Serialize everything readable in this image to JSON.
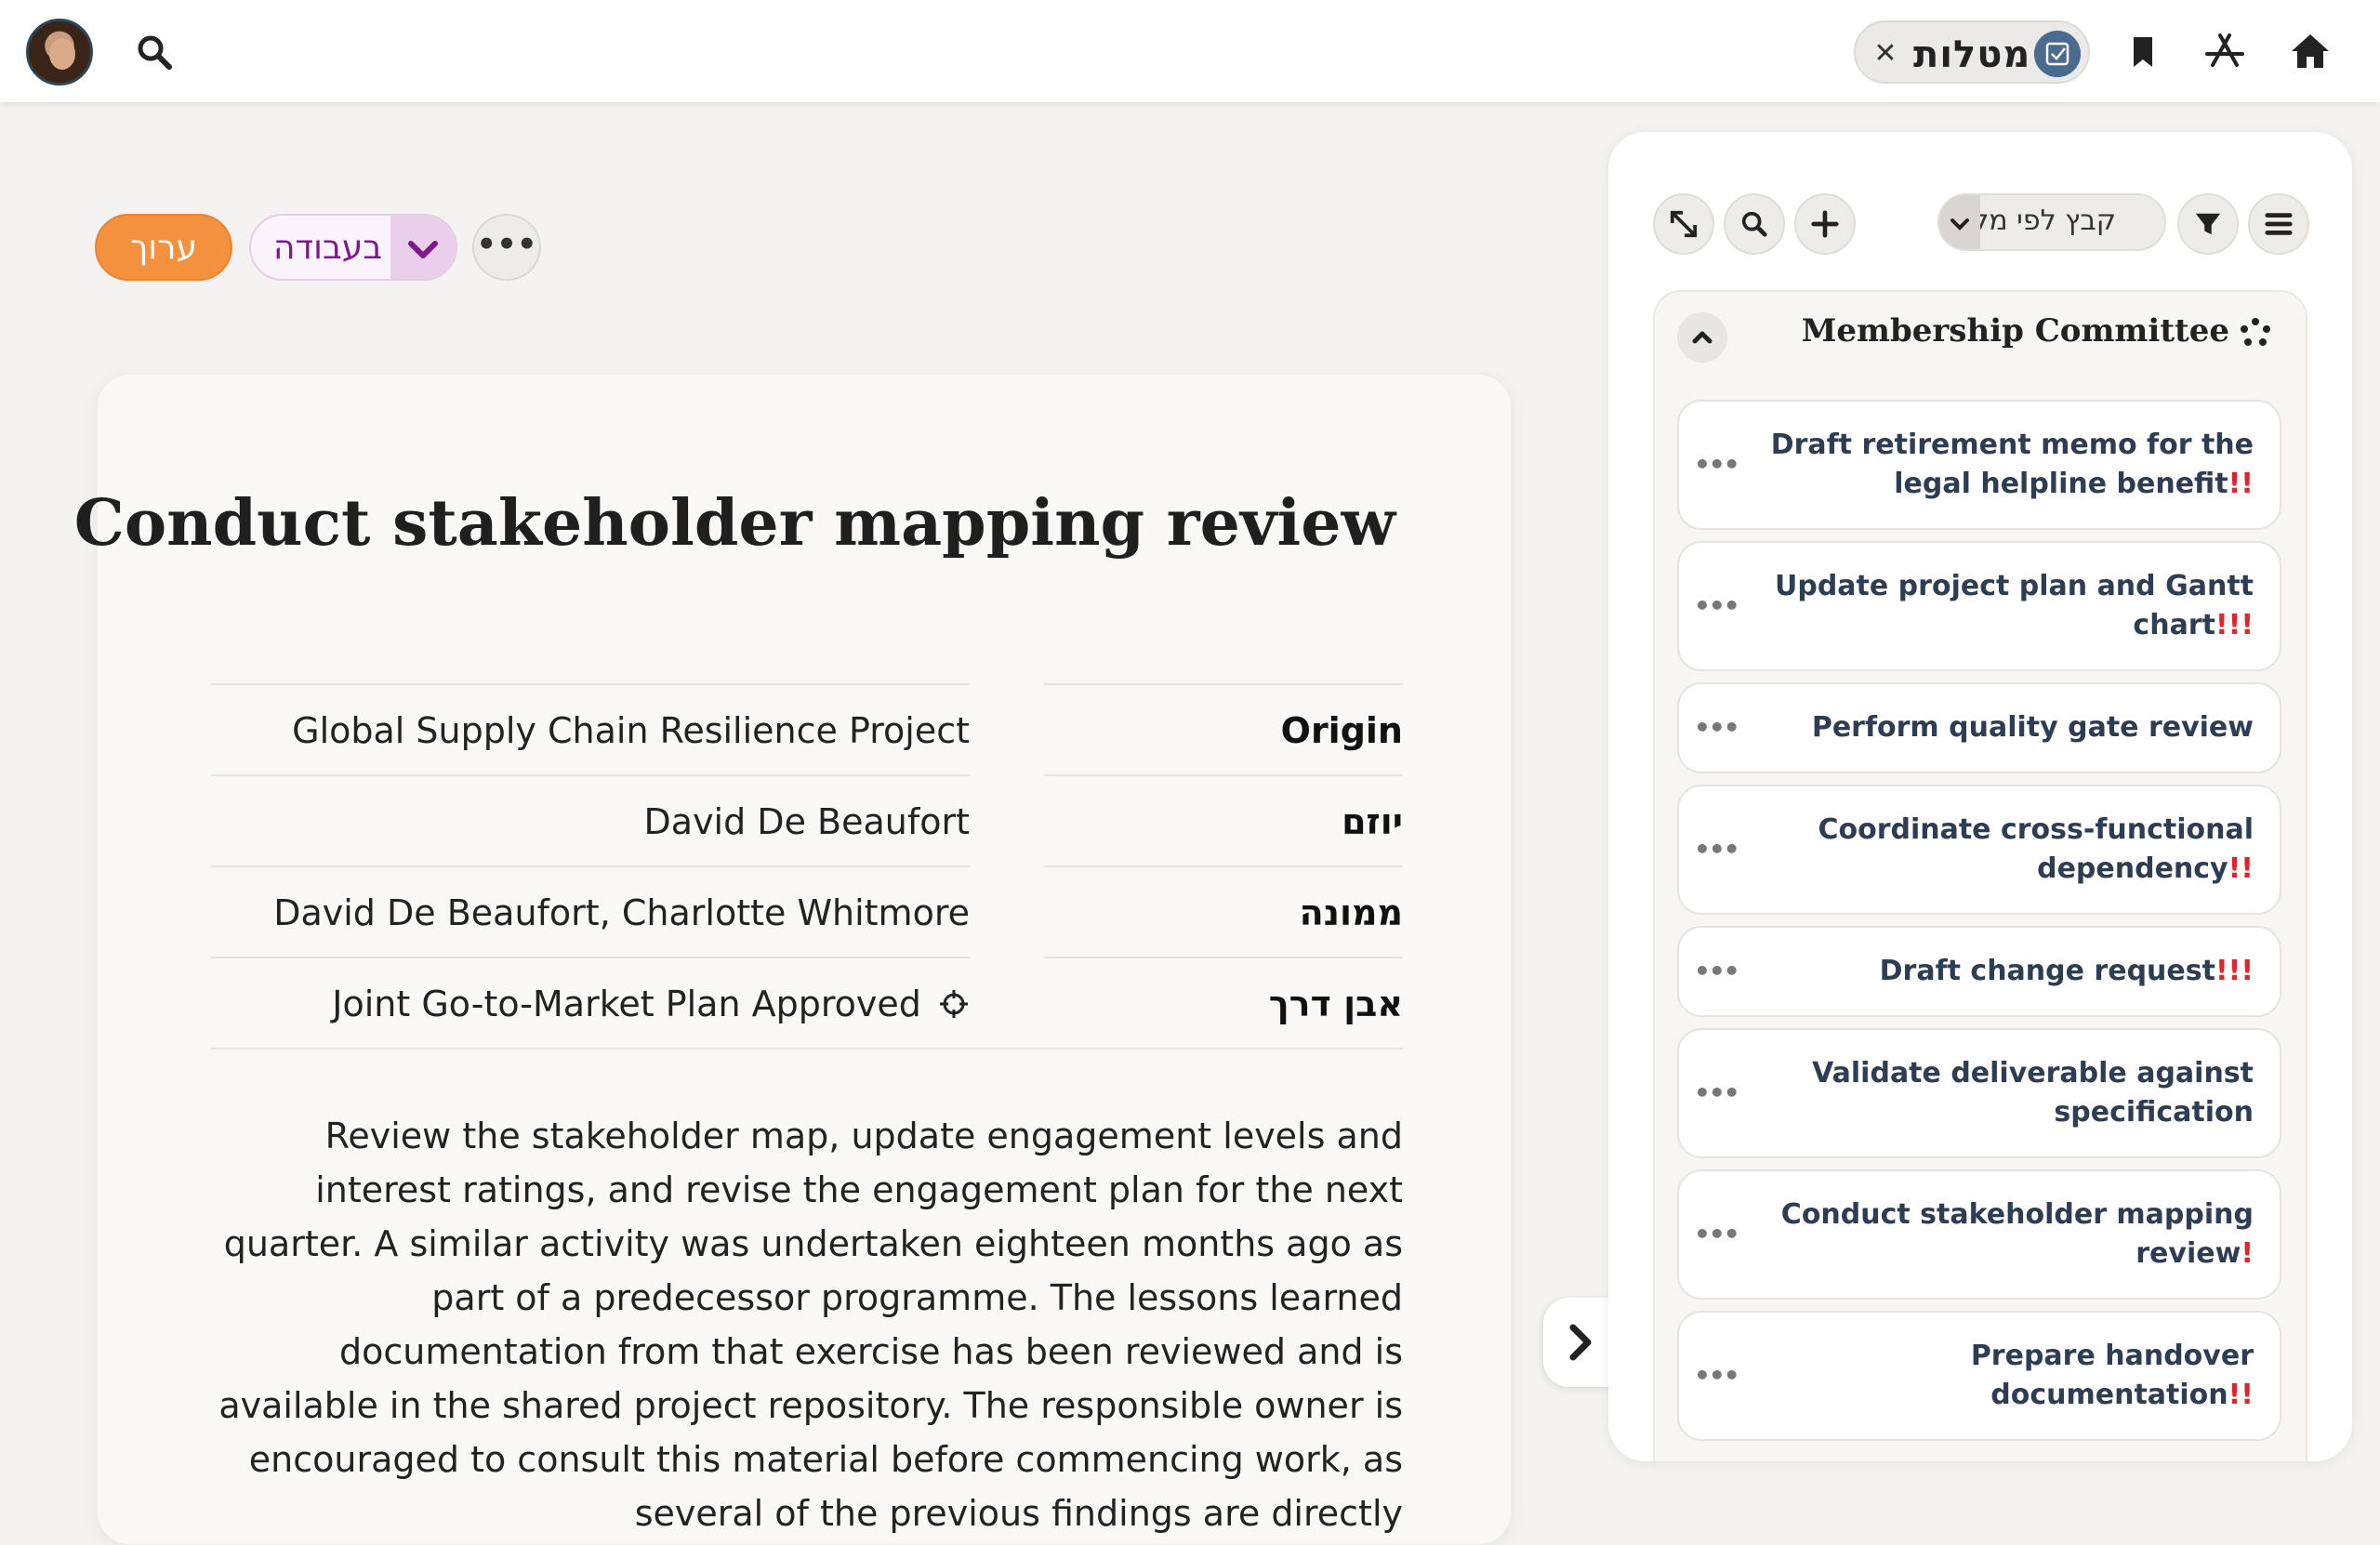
{
  "topbar": {
    "tasks_chip_label": "מטלות",
    "chip_close_glyph": "✕"
  },
  "actions": {
    "edit_label": "ערוך",
    "status_value": "בעבודה",
    "more_glyph": "•••"
  },
  "task": {
    "title": "Conduct stakeholder mapping review",
    "fields": [
      {
        "label": "Origin",
        "value": "Global Supply Chain Resilience Project"
      },
      {
        "label": "יוזם",
        "value": "David De Beaufort"
      },
      {
        "label": "ממונה",
        "value": "David De Beaufort, Charlotte Whitmore"
      },
      {
        "label": "אבן דרך",
        "value": "Joint Go-to-Market Plan Approved"
      }
    ],
    "description": "Review the stakeholder map, update engagement levels and interest ratings, and revise the engagement plan for the next quarter. A similar activity was undertaken eighteen months ago as part of a predecessor programme. The lessons learned documentation from that exercise has been reviewed and is available in the shared project repository. The responsible owner is encouraged to consult this material before commencing work, as several of the previous findings are directly"
  },
  "side_panel": {
    "group_by_label": "קבץ לפי מקור",
    "group": {
      "title": "Membership Committee",
      "tasks": [
        {
          "text": "Draft retirement memo for the legal helpline benefit",
          "priority": "!!"
        },
        {
          "text": "Update project plan and Gantt chart",
          "priority": "!!!"
        },
        {
          "text": "Perform quality gate review",
          "priority": ""
        },
        {
          "text": "Coordinate cross-functional dependency",
          "priority": "!!"
        },
        {
          "text": "Draft change request",
          "priority": "!!!"
        },
        {
          "text": "Validate deliverable against specification",
          "priority": ""
        },
        {
          "text": "Conduct stakeholder mapping review",
          "priority": "!"
        },
        {
          "text": "Prepare handover documentation",
          "priority": "!!"
        }
      ]
    }
  },
  "colors": {
    "accent_orange": "#f4913f",
    "status_purple": "#7d1a8a",
    "priority_red": "#e0242b",
    "chip_blue": "#4a6a8e"
  },
  "icons": [
    "avatar",
    "search-icon",
    "home-icon",
    "appstore-icon",
    "bookmark-icon",
    "checkbox-icon",
    "close-icon",
    "chevron-down-icon",
    "more-icon",
    "target-icon",
    "expand-icon",
    "plus-icon",
    "filter-icon",
    "menu-icon",
    "group-icon",
    "chevron-up-icon",
    "chevron-right-icon"
  ]
}
